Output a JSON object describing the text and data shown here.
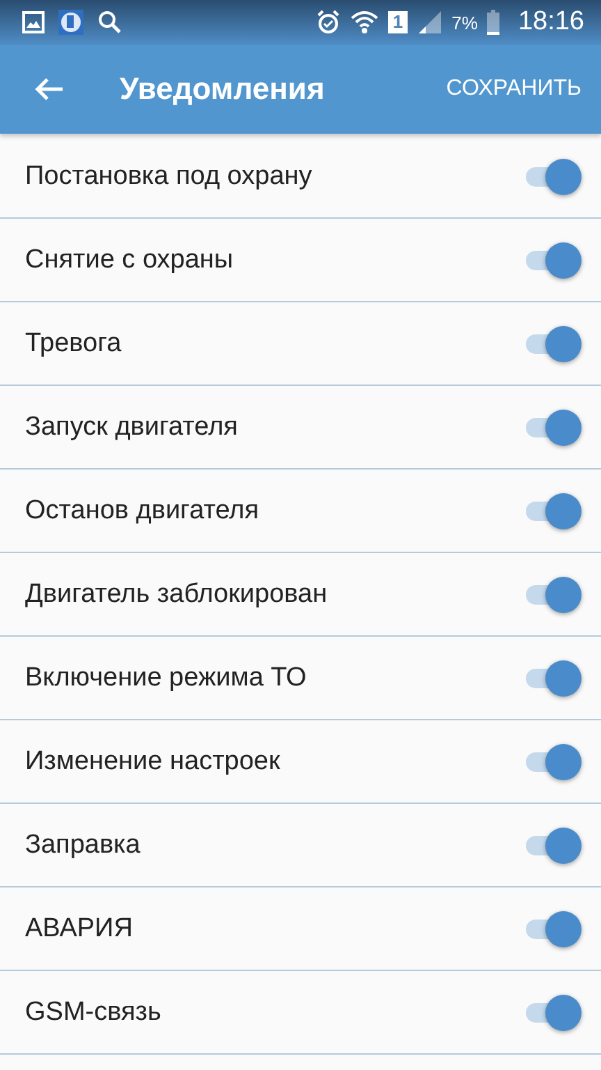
{
  "status_bar": {
    "sim": "1",
    "battery": "7%",
    "time": "18:16"
  },
  "app_bar": {
    "title": "Уведомления",
    "action": "СОХРАНИТЬ"
  },
  "settings": [
    {
      "label": "Постановка под охрану",
      "on": true
    },
    {
      "label": "Снятие с охраны",
      "on": true
    },
    {
      "label": "Тревога",
      "on": true
    },
    {
      "label": "Запуск двигателя",
      "on": true
    },
    {
      "label": "Останов двигателя",
      "on": true
    },
    {
      "label": "Двигатель заблокирован",
      "on": true
    },
    {
      "label": "Включение режима ТО",
      "on": true
    },
    {
      "label": "Изменение настроек",
      "on": true
    },
    {
      "label": "Заправка",
      "on": true
    },
    {
      "label": "АВАРИЯ",
      "on": true
    },
    {
      "label": "GSM-связь",
      "on": true
    }
  ]
}
